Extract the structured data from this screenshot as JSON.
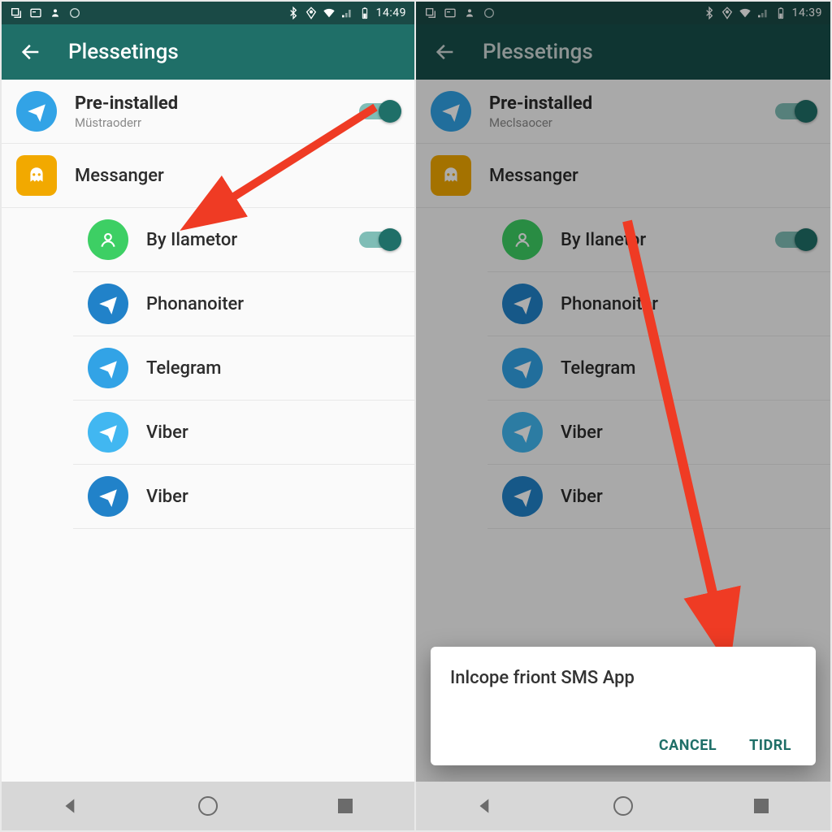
{
  "left": {
    "status_time": "14:49",
    "toolbar_title": "Plessetings",
    "rows": [
      {
        "name": "Pre-installed",
        "sub": "Müstraoderr",
        "icon": "plane",
        "color": "ic-blue",
        "shape": "round",
        "toggle": true,
        "toggle_on": true
      },
      {
        "name": "Messanger",
        "icon": "ghost",
        "color": "ic-yellow",
        "shape": "square"
      },
      {
        "name": "By Ilametor",
        "icon": "person",
        "color": "ic-green",
        "shape": "round",
        "indent": true,
        "toggle": true,
        "toggle_on": true
      },
      {
        "name": "Phonanoiter",
        "icon": "plane",
        "color": "ic-dark",
        "shape": "round",
        "indent": true
      },
      {
        "name": "Telegram",
        "icon": "plane",
        "color": "ic-blue",
        "shape": "round",
        "indent": true
      },
      {
        "name": "Viber",
        "icon": "plane",
        "color": "ic-light",
        "shape": "round",
        "indent": true
      },
      {
        "name": "Viber",
        "icon": "plane",
        "color": "ic-dark",
        "shape": "round",
        "indent": true
      }
    ]
  },
  "right": {
    "status_time": "14:39",
    "toolbar_title": "Plessetings",
    "rows": [
      {
        "name": "Pre-installed",
        "sub": "Meclsaocer",
        "icon": "plane",
        "color": "ic-blue",
        "shape": "round",
        "toggle": true,
        "toggle_on": true
      },
      {
        "name": "Messanger",
        "icon": "ghost",
        "color": "ic-yellow",
        "shape": "square"
      },
      {
        "name": "By Ilanetor",
        "icon": "person",
        "color": "ic-green",
        "shape": "round",
        "indent": true,
        "toggle": true,
        "toggle_on": true
      },
      {
        "name": "Phonanoiter",
        "icon": "plane",
        "color": "ic-dark",
        "shape": "round",
        "indent": true
      },
      {
        "name": "Telegram",
        "icon": "plane",
        "color": "ic-blue",
        "shape": "round",
        "indent": true
      },
      {
        "name": "Viber",
        "icon": "plane",
        "color": "ic-light",
        "shape": "round",
        "indent": true
      },
      {
        "name": "Viber",
        "icon": "plane",
        "color": "ic-dark",
        "shape": "round",
        "indent": true
      }
    ],
    "dialog": {
      "title": "Inlcope friont SMS App",
      "cancel": "CANCEL",
      "ok": "TIDRL"
    }
  },
  "colors": {
    "accent": "#1f6f68",
    "arrow": "#ef3b24"
  }
}
